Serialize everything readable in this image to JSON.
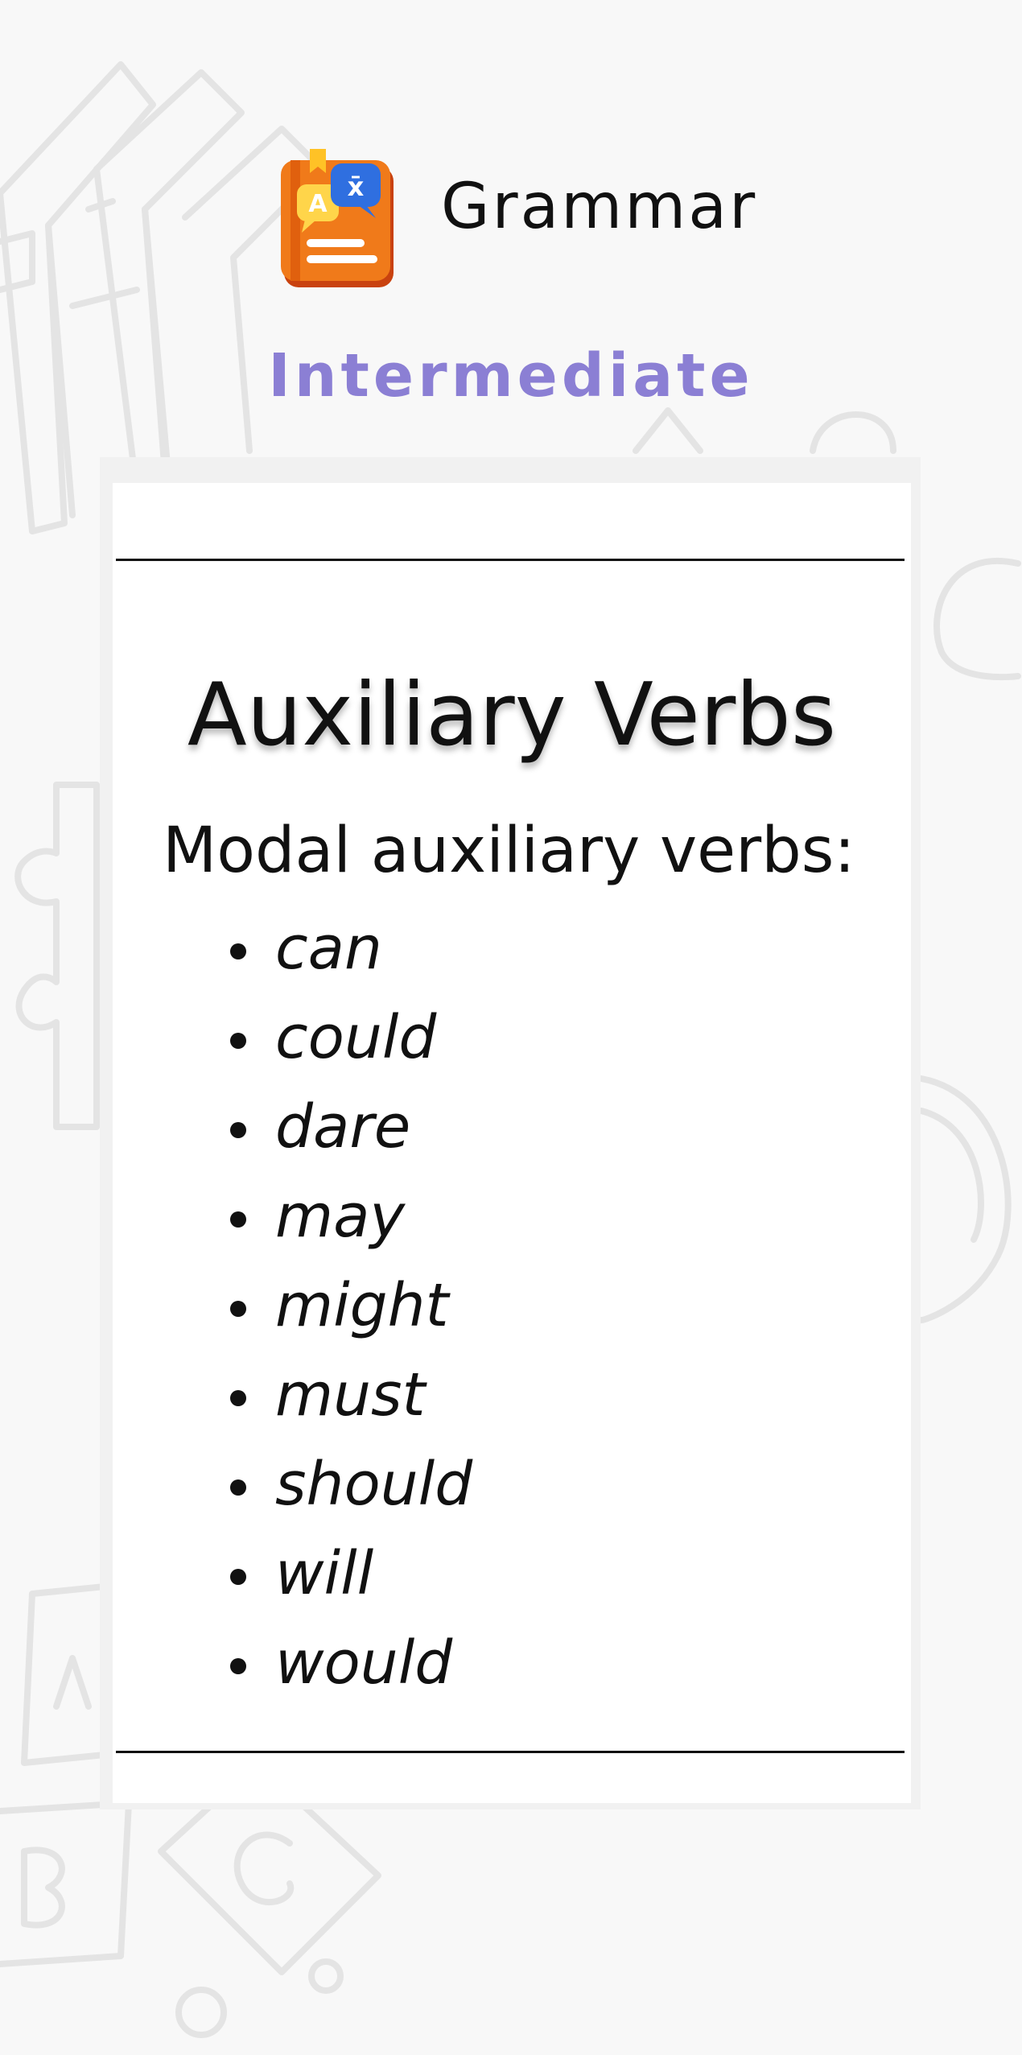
{
  "app": {
    "title": "Grammar",
    "level": "Intermediate",
    "icon": "grammar-book-icon"
  },
  "lesson": {
    "title": "Auxiliary Verbs",
    "section_heading": "Modal auxiliary verbs:",
    "items": [
      {
        "label": "can"
      },
      {
        "label": "could"
      },
      {
        "label": "dare"
      },
      {
        "label": "may"
      },
      {
        "label": "might"
      },
      {
        "label": "must"
      },
      {
        "label": "should"
      },
      {
        "label": "will"
      },
      {
        "label": "would"
      }
    ]
  },
  "colors": {
    "background": "#f8f8f8",
    "level_accent": "#8b7fd4",
    "card": "#ffffff",
    "text": "#111111",
    "icon_orange": "#f07a1a",
    "icon_blue": "#2f6fe0"
  }
}
